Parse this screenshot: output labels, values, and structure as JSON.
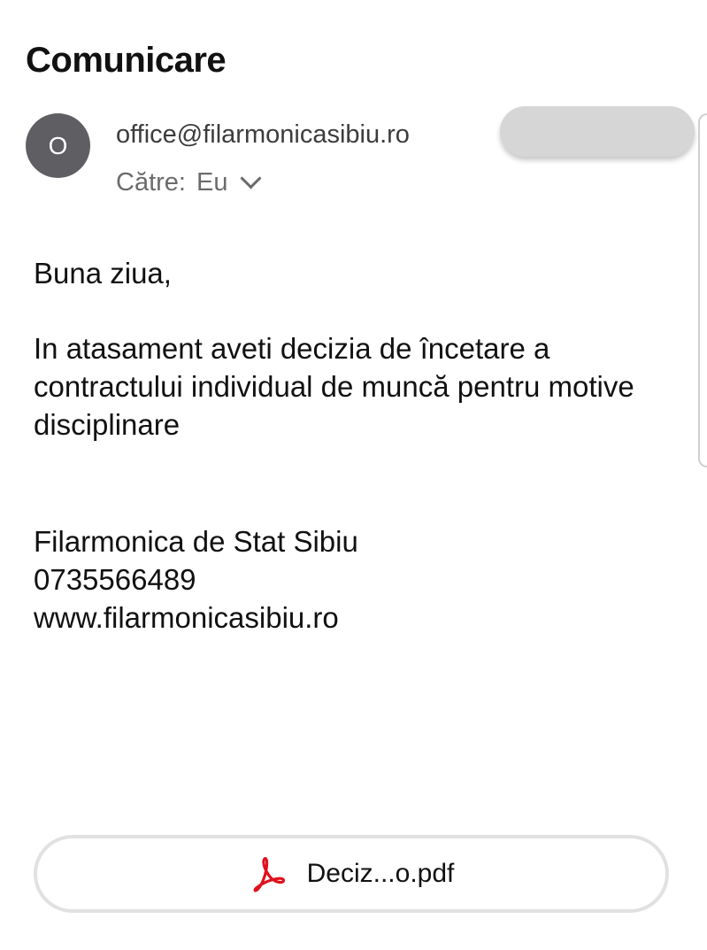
{
  "email": {
    "subject": "Comunicare",
    "avatar_initial": "O",
    "sender": "office@filarmonicasibiu.ro",
    "recipient_label": "Către:",
    "recipient_value": "Eu",
    "body": {
      "greeting": "Buna ziua,",
      "message": "In atasament aveti decizia de încetare a contractului individual de muncă pentru motive disciplinare",
      "signature": {
        "name": "Filarmonica de Stat Sibiu",
        "phone": "0735566489",
        "website": "www.filarmonicasibiu.ro"
      }
    },
    "attachment": {
      "icon": "pdf-icon",
      "filename": "Deciz...o.pdf"
    }
  },
  "colors": {
    "avatar_bg": "#5f5f63",
    "pdf_red": "#e0101c",
    "secondary_text": "#6b6b6b",
    "redacted": "#d6d6d6"
  }
}
